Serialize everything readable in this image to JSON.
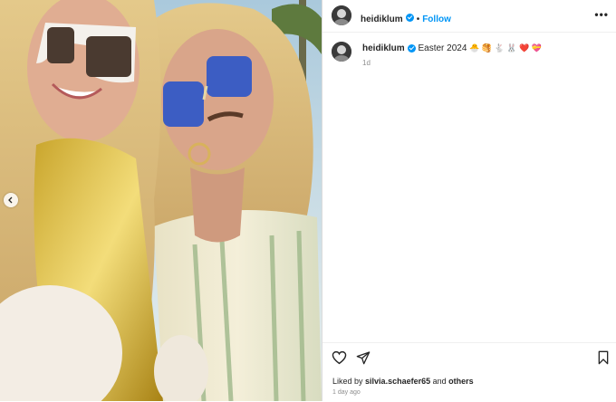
{
  "post": {
    "username": "heidiklum",
    "verified": true,
    "follow_label": "Follow",
    "separator": "•",
    "more_label": "•••",
    "caption": {
      "username": "heidiklum",
      "text": "Easter 2024",
      "emojis": "🐣 🥞 🐇 🐰 ❤️ 💝",
      "time": "1d"
    },
    "likes": {
      "prefix": "Liked by",
      "user": "silvia.schaefer65",
      "and": "and",
      "others": "others"
    },
    "timestamp": "1 day ago"
  },
  "icons": {
    "like": "heart-icon",
    "share": "paper-plane-icon",
    "save": "bookmark-icon",
    "prev": "chevron-left-icon",
    "verified": "verified-badge-icon",
    "more": "more-options-icon"
  },
  "colors": {
    "accent": "#0095f6",
    "text": "#262626",
    "muted": "#8e8e8e",
    "divider": "#dbdbdb"
  }
}
